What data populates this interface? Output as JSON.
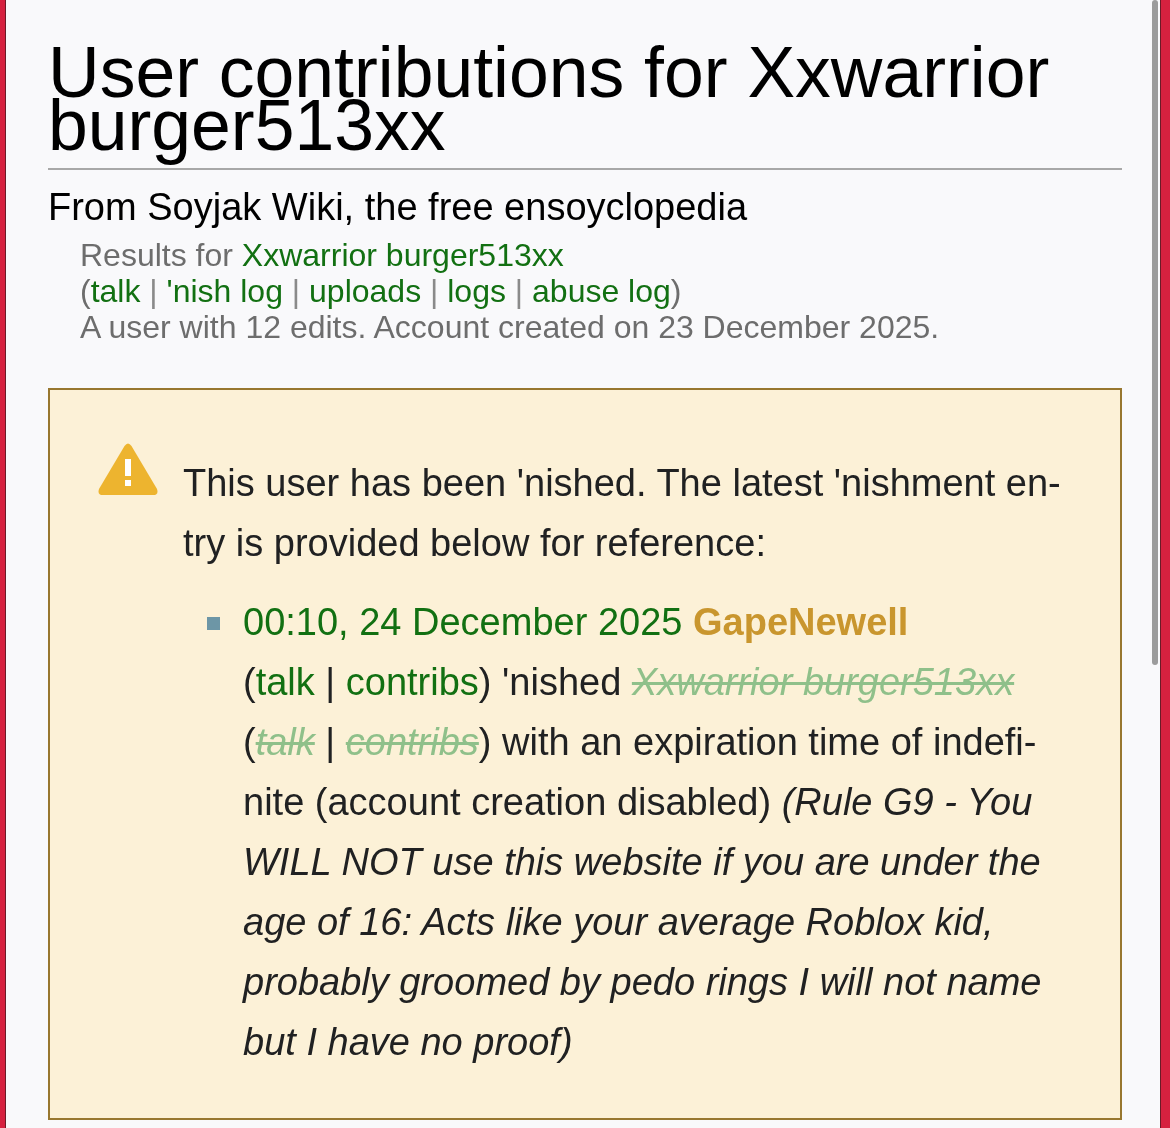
{
  "page": {
    "title": "User contributions for Xxwarrior burger513xx",
    "tagline": "From Soyjak Wiki, the free ensoyclopedia"
  },
  "results": {
    "heading": [
      {
        "kind": "text",
        "text": "Results for"
      },
      {
        "kind": "link",
        "text": "Xxwarrior burger513xx"
      }
    ],
    "tool_links": [
      {
        "kind": "tools",
        "items": [
          {
            "kind": "text",
            "text": "("
          },
          {
            "kind": "link",
            "text": "talk"
          },
          {
            "kind": "separator",
            "text": "|"
          },
          {
            "kind": "link",
            "text": "'nish log"
          },
          {
            "kind": "separator",
            "text": "|"
          },
          {
            "kind": "link",
            "text": "uploads"
          },
          {
            "kind": "separator",
            "text": "|"
          },
          {
            "kind": "link",
            "text": "logs"
          },
          {
            "kind": "separator",
            "text": "|"
          },
          {
            "kind": "link",
            "text": "abuse log"
          },
          {
            "kind": "text",
            "text": ")"
          }
        ]
      }
    ],
    "summary": "A user with 12 edits. Account created on 23 December 2025."
  },
  "notice": {
    "message": "This user has been 'nished. The latest 'nishment en-try is provided below for reference:",
    "entries": [
      {
        "segments": [
          {
            "kind": "link",
            "text": "00:10, 24 December 2025"
          },
          {
            "kind": "user",
            "text": "GapeNewell"
          },
          {
            "kind": "tools",
            "items": [
              {
                "kind": "text",
                "text": "("
              },
              {
                "kind": "link",
                "text": "talk"
              },
              {
                "kind": "separator",
                "text": "|"
              },
              {
                "kind": "link",
                "text": "contribs"
              },
              {
                "kind": "text",
                "text": ")"
              }
            ]
          },
          {
            "kind": "text",
            "text": "'nished"
          },
          {
            "kind": "struck",
            "text": "Xxwarrior burger513xx"
          },
          {
            "kind": "tools",
            "items": [
              {
                "kind": "text",
                "text": "("
              },
              {
                "kind": "struck",
                "text": "talk"
              },
              {
                "kind": "separator",
                "text": "|"
              },
              {
                "kind": "struck",
                "text": "contribs"
              },
              {
                "kind": "text",
                "text": ")"
              }
            ]
          },
          {
            "kind": "text",
            "text": "with an expiration time of indefi-nite (account creation disabled)"
          },
          {
            "kind": "comment",
            "text": "(Rule G9 - You WILL NOT use this website if you are under the age of 16: Acts like your average Roblox kid, probably groomed by pedo rings I will not name but I have no proof)"
          }
        ]
      }
    ]
  }
}
